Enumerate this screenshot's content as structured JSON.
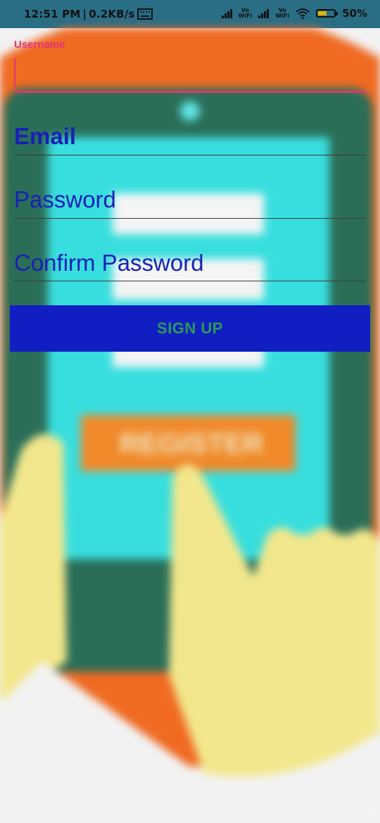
{
  "status_bar": {
    "time": "12:51 PM",
    "net_speed": "0.2KB/s",
    "vo_wifi_1": [
      "Vo",
      "WiFi"
    ],
    "vo_wifi_2": [
      "Vo",
      "WiFi"
    ],
    "battery_percent": "50%",
    "battery_level": 0.5
  },
  "form": {
    "username_label": "Username",
    "username_value": "",
    "email_hint": "Email",
    "password_hint": "Password",
    "confirm_password_hint": "Confirm Password",
    "signup_label": "SIGN UP"
  },
  "background": {
    "illustration_text": "REGISTER"
  },
  "colors": {
    "status_bar": "#2a6e86",
    "accent_pink": "#e0357a",
    "hint_blue": "#1a1fb8",
    "button_blue": "#111fc2",
    "button_text_green": "#2a9a58"
  }
}
